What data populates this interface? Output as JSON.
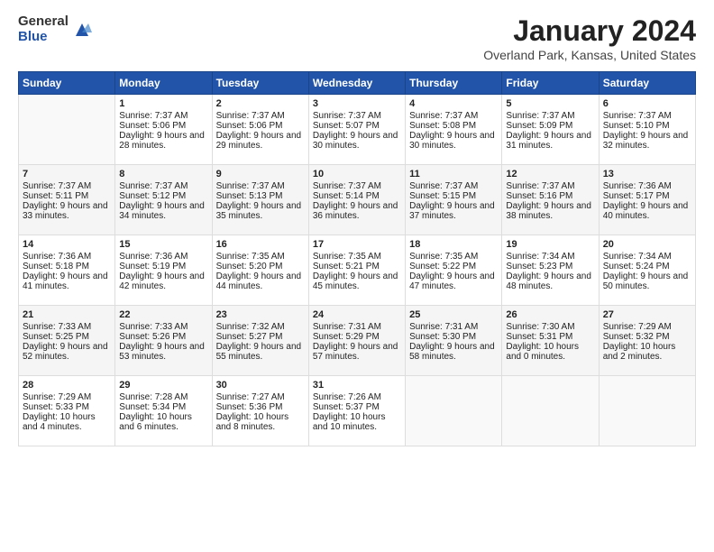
{
  "header": {
    "logo_general": "General",
    "logo_blue": "Blue",
    "month_title": "January 2024",
    "location": "Overland Park, Kansas, United States"
  },
  "days_of_week": [
    "Sunday",
    "Monday",
    "Tuesday",
    "Wednesday",
    "Thursday",
    "Friday",
    "Saturday"
  ],
  "weeks": [
    [
      {
        "day": "",
        "sunrise": "",
        "sunset": "",
        "daylight": ""
      },
      {
        "day": "1",
        "sunrise": "Sunrise: 7:37 AM",
        "sunset": "Sunset: 5:06 PM",
        "daylight": "Daylight: 9 hours and 28 minutes."
      },
      {
        "day": "2",
        "sunrise": "Sunrise: 7:37 AM",
        "sunset": "Sunset: 5:06 PM",
        "daylight": "Daylight: 9 hours and 29 minutes."
      },
      {
        "day": "3",
        "sunrise": "Sunrise: 7:37 AM",
        "sunset": "Sunset: 5:07 PM",
        "daylight": "Daylight: 9 hours and 30 minutes."
      },
      {
        "day": "4",
        "sunrise": "Sunrise: 7:37 AM",
        "sunset": "Sunset: 5:08 PM",
        "daylight": "Daylight: 9 hours and 30 minutes."
      },
      {
        "day": "5",
        "sunrise": "Sunrise: 7:37 AM",
        "sunset": "Sunset: 5:09 PM",
        "daylight": "Daylight: 9 hours and 31 minutes."
      },
      {
        "day": "6",
        "sunrise": "Sunrise: 7:37 AM",
        "sunset": "Sunset: 5:10 PM",
        "daylight": "Daylight: 9 hours and 32 minutes."
      }
    ],
    [
      {
        "day": "7",
        "sunrise": "Sunrise: 7:37 AM",
        "sunset": "Sunset: 5:11 PM",
        "daylight": "Daylight: 9 hours and 33 minutes."
      },
      {
        "day": "8",
        "sunrise": "Sunrise: 7:37 AM",
        "sunset": "Sunset: 5:12 PM",
        "daylight": "Daylight: 9 hours and 34 minutes."
      },
      {
        "day": "9",
        "sunrise": "Sunrise: 7:37 AM",
        "sunset": "Sunset: 5:13 PM",
        "daylight": "Daylight: 9 hours and 35 minutes."
      },
      {
        "day": "10",
        "sunrise": "Sunrise: 7:37 AM",
        "sunset": "Sunset: 5:14 PM",
        "daylight": "Daylight: 9 hours and 36 minutes."
      },
      {
        "day": "11",
        "sunrise": "Sunrise: 7:37 AM",
        "sunset": "Sunset: 5:15 PM",
        "daylight": "Daylight: 9 hours and 37 minutes."
      },
      {
        "day": "12",
        "sunrise": "Sunrise: 7:37 AM",
        "sunset": "Sunset: 5:16 PM",
        "daylight": "Daylight: 9 hours and 38 minutes."
      },
      {
        "day": "13",
        "sunrise": "Sunrise: 7:36 AM",
        "sunset": "Sunset: 5:17 PM",
        "daylight": "Daylight: 9 hours and 40 minutes."
      }
    ],
    [
      {
        "day": "14",
        "sunrise": "Sunrise: 7:36 AM",
        "sunset": "Sunset: 5:18 PM",
        "daylight": "Daylight: 9 hours and 41 minutes."
      },
      {
        "day": "15",
        "sunrise": "Sunrise: 7:36 AM",
        "sunset": "Sunset: 5:19 PM",
        "daylight": "Daylight: 9 hours and 42 minutes."
      },
      {
        "day": "16",
        "sunrise": "Sunrise: 7:35 AM",
        "sunset": "Sunset: 5:20 PM",
        "daylight": "Daylight: 9 hours and 44 minutes."
      },
      {
        "day": "17",
        "sunrise": "Sunrise: 7:35 AM",
        "sunset": "Sunset: 5:21 PM",
        "daylight": "Daylight: 9 hours and 45 minutes."
      },
      {
        "day": "18",
        "sunrise": "Sunrise: 7:35 AM",
        "sunset": "Sunset: 5:22 PM",
        "daylight": "Daylight: 9 hours and 47 minutes."
      },
      {
        "day": "19",
        "sunrise": "Sunrise: 7:34 AM",
        "sunset": "Sunset: 5:23 PM",
        "daylight": "Daylight: 9 hours and 48 minutes."
      },
      {
        "day": "20",
        "sunrise": "Sunrise: 7:34 AM",
        "sunset": "Sunset: 5:24 PM",
        "daylight": "Daylight: 9 hours and 50 minutes."
      }
    ],
    [
      {
        "day": "21",
        "sunrise": "Sunrise: 7:33 AM",
        "sunset": "Sunset: 5:25 PM",
        "daylight": "Daylight: 9 hours and 52 minutes."
      },
      {
        "day": "22",
        "sunrise": "Sunrise: 7:33 AM",
        "sunset": "Sunset: 5:26 PM",
        "daylight": "Daylight: 9 hours and 53 minutes."
      },
      {
        "day": "23",
        "sunrise": "Sunrise: 7:32 AM",
        "sunset": "Sunset: 5:27 PM",
        "daylight": "Daylight: 9 hours and 55 minutes."
      },
      {
        "day": "24",
        "sunrise": "Sunrise: 7:31 AM",
        "sunset": "Sunset: 5:29 PM",
        "daylight": "Daylight: 9 hours and 57 minutes."
      },
      {
        "day": "25",
        "sunrise": "Sunrise: 7:31 AM",
        "sunset": "Sunset: 5:30 PM",
        "daylight": "Daylight: 9 hours and 58 minutes."
      },
      {
        "day": "26",
        "sunrise": "Sunrise: 7:30 AM",
        "sunset": "Sunset: 5:31 PM",
        "daylight": "Daylight: 10 hours and 0 minutes."
      },
      {
        "day": "27",
        "sunrise": "Sunrise: 7:29 AM",
        "sunset": "Sunset: 5:32 PM",
        "daylight": "Daylight: 10 hours and 2 minutes."
      }
    ],
    [
      {
        "day": "28",
        "sunrise": "Sunrise: 7:29 AM",
        "sunset": "Sunset: 5:33 PM",
        "daylight": "Daylight: 10 hours and 4 minutes."
      },
      {
        "day": "29",
        "sunrise": "Sunrise: 7:28 AM",
        "sunset": "Sunset: 5:34 PM",
        "daylight": "Daylight: 10 hours and 6 minutes."
      },
      {
        "day": "30",
        "sunrise": "Sunrise: 7:27 AM",
        "sunset": "Sunset: 5:36 PM",
        "daylight": "Daylight: 10 hours and 8 minutes."
      },
      {
        "day": "31",
        "sunrise": "Sunrise: 7:26 AM",
        "sunset": "Sunset: 5:37 PM",
        "daylight": "Daylight: 10 hours and 10 minutes."
      },
      {
        "day": "",
        "sunrise": "",
        "sunset": "",
        "daylight": ""
      },
      {
        "day": "",
        "sunrise": "",
        "sunset": "",
        "daylight": ""
      },
      {
        "day": "",
        "sunrise": "",
        "sunset": "",
        "daylight": ""
      }
    ]
  ]
}
